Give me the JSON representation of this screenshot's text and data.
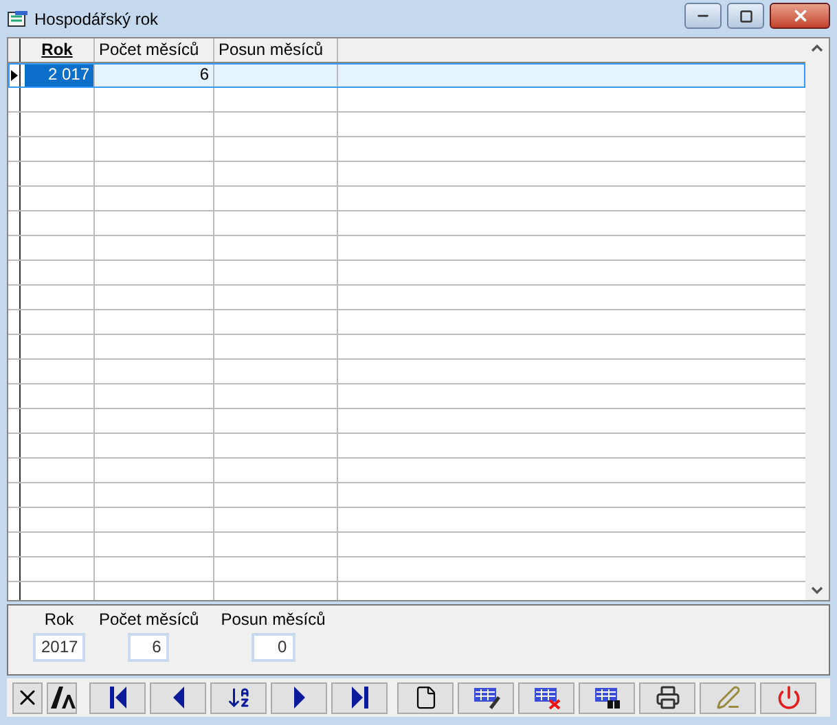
{
  "window": {
    "title": "Hospodářský rok"
  },
  "table": {
    "columns": [
      {
        "label": "Rok",
        "sorted": true
      },
      {
        "label": "Počet měsíců",
        "sorted": false
      },
      {
        "label": "Posun měsíců",
        "sorted": false
      }
    ],
    "rows": [
      {
        "selected": true,
        "cells": [
          "2 017",
          "6",
          ""
        ]
      }
    ]
  },
  "detail": {
    "fields": [
      {
        "label": "Rok",
        "value": "2017"
      },
      {
        "label": "Počet měsíců",
        "value": "6"
      },
      {
        "label": "Posun měsíců",
        "value": "0"
      }
    ]
  },
  "toolbar": [
    {
      "kind": "close"
    },
    {
      "kind": "font"
    },
    {
      "kind": "first"
    },
    {
      "kind": "prev"
    },
    {
      "kind": "sort"
    },
    {
      "kind": "next"
    },
    {
      "kind": "last"
    },
    {
      "kind": "new"
    },
    {
      "kind": "edit"
    },
    {
      "kind": "delete"
    },
    {
      "kind": "find"
    },
    {
      "kind": "print"
    },
    {
      "kind": "tools"
    },
    {
      "kind": "power"
    }
  ]
}
